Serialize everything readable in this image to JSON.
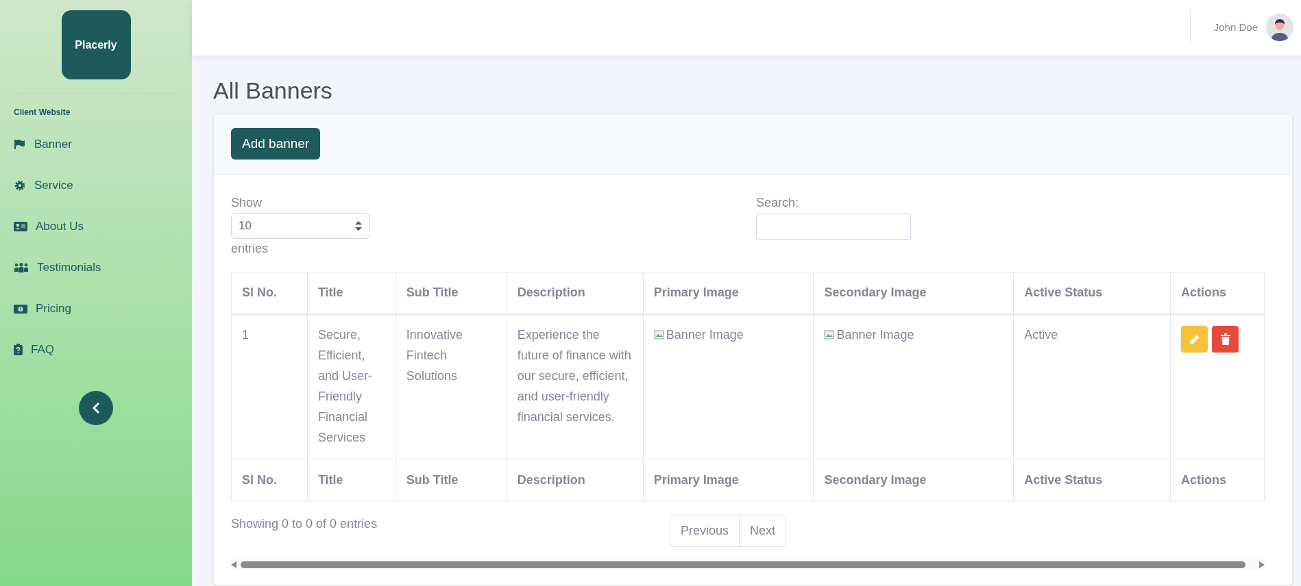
{
  "logo": {
    "text": "Placerly"
  },
  "sidebar": {
    "section_heading": "Client Website",
    "items": [
      {
        "label": "Banner"
      },
      {
        "label": "Service"
      },
      {
        "label": "About Us"
      },
      {
        "label": "Testimonials"
      },
      {
        "label": "Pricing"
      },
      {
        "label": "FAQ"
      }
    ]
  },
  "header": {
    "user_name": "John Doe"
  },
  "page_title": "All Banners",
  "add_button": "Add banner",
  "length_control": {
    "label_before": "Show",
    "value": "10",
    "label_after": "entries"
  },
  "search": {
    "label": "Search:"
  },
  "table": {
    "columns": [
      "Sl No.",
      "Title",
      "Sub Title",
      "Description",
      "Primary Image",
      "Secondary Image",
      "Active Status",
      "Actions"
    ],
    "rows": [
      {
        "cells": [
          "1",
          "Secure, Efficient, and User-Friendly Financial Services",
          "Innovative Fintech Solutions",
          "Experience the future of finance with our secure, efficient, and user-friendly financial services.",
          "Banner Image",
          "Banner Image",
          "Active"
        ]
      }
    ],
    "footer_columns": [
      "Sl No.",
      "Title",
      "Sub Title",
      "Description",
      "Primary Image",
      "Secondary Image",
      "Active Status",
      "Actions"
    ]
  },
  "info": "Showing 0 to 0 of 0 entries",
  "pagination": [
    "Previous",
    "Next"
  ]
}
